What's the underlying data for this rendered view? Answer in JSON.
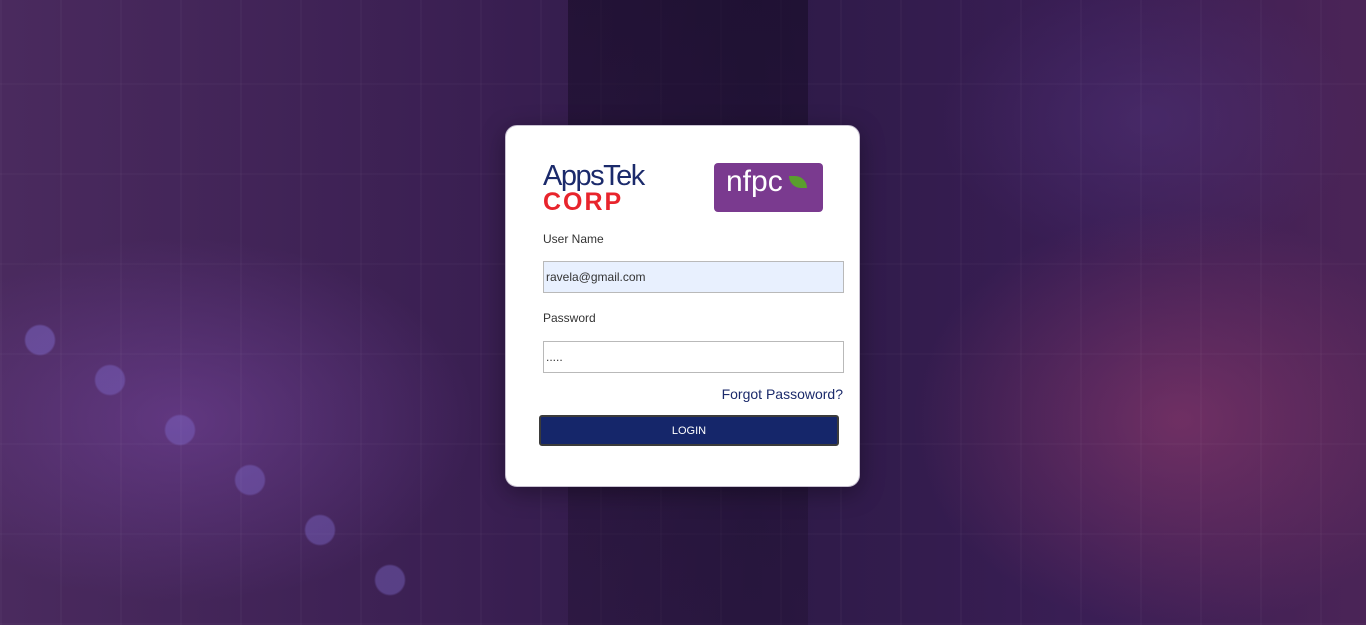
{
  "brand": {
    "appstek_top": "AppsTek",
    "appstek_bottom": "CORP",
    "nfpc_text": "nfpc",
    "colors": {
      "appstek_blue": "#1b2a6b",
      "appstek_red": "#e8242c",
      "nfpc_purple": "#7a3a8f",
      "button": "#15266a"
    }
  },
  "form": {
    "username_label": "User Name",
    "username_value": "ravela@gmail.com",
    "password_label": "Password",
    "password_value": ".....",
    "forgot_link": "Forgot Passoword?",
    "login_button": "LOGIN"
  }
}
